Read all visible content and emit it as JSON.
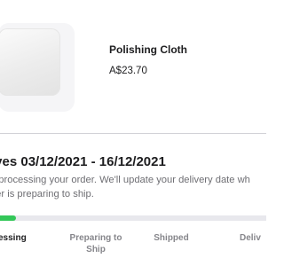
{
  "product": {
    "name": "Polishing Cloth",
    "price": "A$23.70"
  },
  "delivery": {
    "heading": "ives 03/12/2021 - 16/12/2021",
    "message": "are processing your order. We'll update your delivery date wh order is preparing to ship."
  },
  "progress": {
    "fraction": 0.07,
    "accent_color": "#34c759",
    "steps": [
      {
        "label": "essing",
        "active": true
      },
      {
        "label": "Preparing to\nShip",
        "active": false
      },
      {
        "label": "Shipped",
        "active": false
      },
      {
        "label": "Deliv",
        "active": false
      }
    ]
  }
}
